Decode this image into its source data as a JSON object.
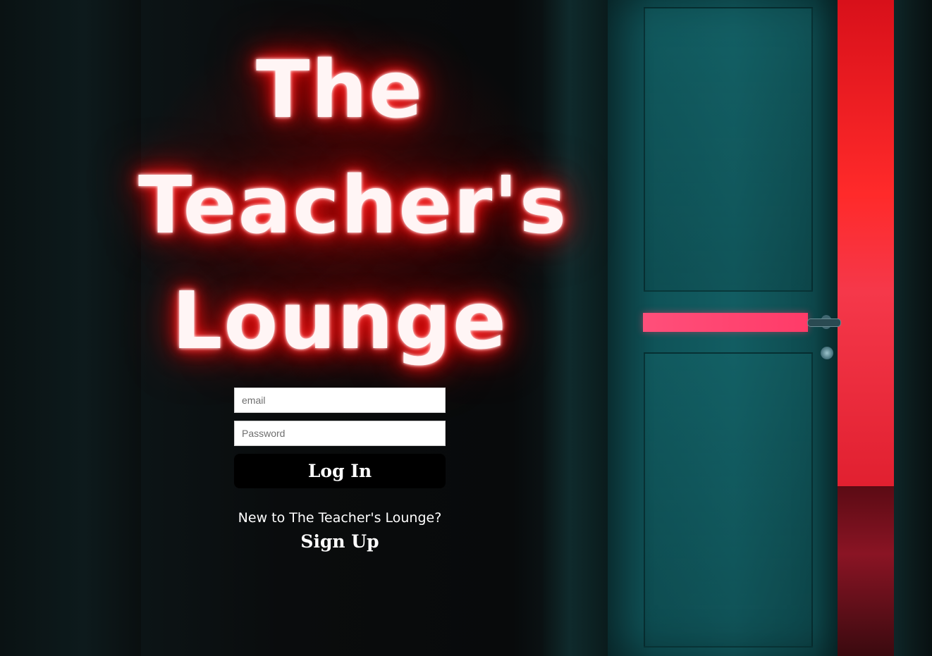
{
  "branding": {
    "title_lines": [
      "The",
      "Teacher's",
      "Lounge"
    ]
  },
  "login_form": {
    "email_placeholder": "email",
    "password_placeholder": "Password",
    "login_label": "Log In"
  },
  "signup": {
    "prompt": "New to The Teacher's Lounge?",
    "link_label": "Sign Up"
  },
  "colors": {
    "background": "#0b0f11",
    "title_glow": "#e60000",
    "door": "#125d62",
    "door_stripe": "#ff3b68",
    "red_room": "#ff2a2a",
    "button": "#000000"
  }
}
